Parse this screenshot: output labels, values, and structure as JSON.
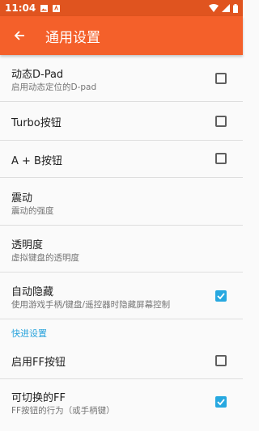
{
  "status_bar": {
    "time": "11:04"
  },
  "app_bar": {
    "title": "通用设置",
    "back_icon": "arrow-back-icon"
  },
  "settings": [
    {
      "title": "动态D-Pad",
      "summary": "启用动态定位的D-pad",
      "checked": false
    },
    {
      "title": "Turbo按钮",
      "checked": false
    },
    {
      "title": "A + B按钮",
      "checked": false
    },
    {
      "title": "震动",
      "summary": "震动的强度"
    },
    {
      "title": "透明度",
      "summary": "虚拟键盘的透明度"
    },
    {
      "title": "自动隐藏",
      "summary": "使用游戏手柄/键盘/遥控器时隐藏屏幕控制",
      "checked": true
    }
  ],
  "section_header": "快进设置",
  "ff_settings": [
    {
      "title": "启用FF按钮",
      "checked": false
    },
    {
      "title": "可切换的FF",
      "summary": "FF按钮的行为（或手柄键）",
      "checked": true
    }
  ],
  "colors": {
    "accent": "#27a8e0",
    "app_bar": "#f4602a",
    "status_bar": "#e0541f"
  }
}
